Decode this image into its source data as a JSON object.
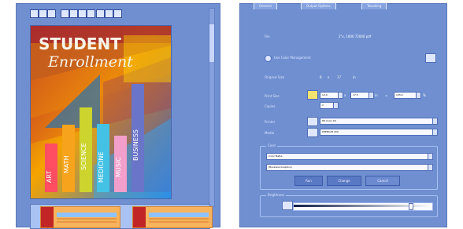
{
  "left_panel": {
    "cover": {
      "title_line1": "STUDENT",
      "title_line2": "Enrollment",
      "bars": [
        "ART",
        "MATH",
        "SCIENCE",
        "MEDICINE",
        "MUSIC",
        "BUSINESS"
      ]
    }
  },
  "print_dialog": {
    "tabs": [
      "General",
      "Output Options",
      "Tweaking"
    ],
    "fields": {
      "file_label": "File",
      "file_value": "2\"x, 1000 72000 pdf",
      "color_management_label": "Use Color Management",
      "original_size_label": "Original Size",
      "original_size_w": "8",
      "original_size_x": "x",
      "original_size_h": "17",
      "original_size_unit": "in",
      "print_size_label": "Print Size",
      "print_size_w": "12.0",
      "print_size_x": "x",
      "print_size_h": "17.5",
      "print_size_unit": "in",
      "print_size_result": "145.6",
      "print_size_suffix": "%",
      "copies_label": "Copies",
      "copies_value": "2",
      "printer_label": "Printer",
      "printer_value": "HP Color 90",
      "media_label": "Media",
      "media_value": "PREMIUM 200",
      "color_label": "Color",
      "color_mode_value": "Color Matte",
      "rendering_value": "(Business Graphics)",
      "buttons": [
        "Run",
        "Change",
        "Cancel"
      ],
      "brightness_label": "Brightness"
    }
  }
}
